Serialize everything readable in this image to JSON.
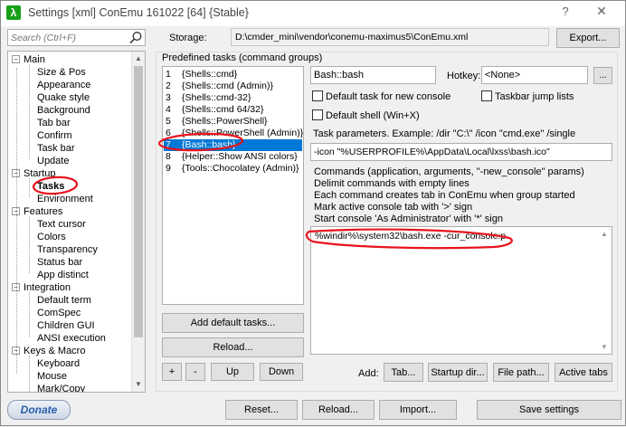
{
  "window": {
    "title": "Settings [xml] ConEmu 161022 [64] {Stable}",
    "app_icon_glyph": "λ",
    "help_label": "?",
    "close_label": "✕"
  },
  "search": {
    "placeholder": "Search (Ctrl+F)"
  },
  "storage": {
    "label": "Storage:",
    "path": "D:\\cmder_mini\\vendor\\conemu-maximus5\\ConEmu.xml",
    "export_label": "Export..."
  },
  "tree": {
    "main": "Main",
    "main_children": [
      "Size & Pos",
      "Appearance",
      "Quake style",
      "Background",
      "Tab bar",
      "Confirm",
      "Task bar",
      "Update"
    ],
    "startup": "Startup",
    "startup_children": [
      "Tasks",
      "Environment"
    ],
    "features": "Features",
    "features_children": [
      "Text cursor",
      "Colors",
      "Transparency",
      "Status bar",
      "App distinct"
    ],
    "integration": "Integration",
    "integration_children": [
      "Default term",
      "ComSpec",
      "Children GUI",
      "ANSI execution"
    ],
    "keys": "Keys & Macro",
    "keys_children": [
      "Keyboard",
      "Mouse",
      "Mark/Copy"
    ]
  },
  "tasks": {
    "group_title": "Predefined tasks (command groups)",
    "items": [
      {
        "num": "1",
        "name": "{Shells::cmd}"
      },
      {
        "num": "2",
        "name": "{Shells::cmd (Admin)}"
      },
      {
        "num": "3",
        "name": "{Shells::cmd-32}"
      },
      {
        "num": "4",
        "name": "{Shells::cmd 64/32}"
      },
      {
        "num": "5",
        "name": "{Shells::PowerShell}"
      },
      {
        "num": "6",
        "name": "{Shells::PowerShell (Admin)}"
      },
      {
        "num": "7",
        "name": "{Bash::bash}"
      },
      {
        "num": "8",
        "name": "{Helper::Show ANSI colors}"
      },
      {
        "num": "9",
        "name": "{Tools::Chocolatey (Admin)}"
      }
    ],
    "add_default_label": "Add default tasks...",
    "reload_label": "Reload...",
    "plus_label": "+",
    "minus_label": "-",
    "up_label": "Up",
    "down_label": "Down"
  },
  "task_detail": {
    "name": "Bash::bash",
    "hotkey_label": "Hotkey:",
    "hotkey_value": "<None>",
    "hotkey_more": "...",
    "default_task_label": "Default task for new console",
    "taskbar_jump_label": "Taskbar jump lists",
    "default_shell_label": "Default shell (Win+X)",
    "params_label": "Task parameters. Example: /dir \"C:\\\" /icon \"cmd.exe\" /single",
    "params_value": "-icon \"%USERPROFILE%\\AppData\\Local\\lxss\\bash.ico\"",
    "help_lines": [
      "Commands (application, arguments, \"-new_console\" params)",
      "Delimit commands with empty lines",
      "Each command creates tab in ConEmu when group started",
      "Mark active console tab with '>' sign",
      "Start console 'As Administrator' with '*' sign"
    ],
    "commands": "%windir%\\system32\\bash.exe -cur_console:p",
    "add_label": "Add:",
    "tab_btn": "Tab...",
    "startup_dir_btn": "Startup dir...",
    "file_path_btn": "File path...",
    "active_tabs_btn": "Active tabs"
  },
  "footer": {
    "donate": "Donate",
    "reset": "Reset...",
    "reload": "Reload...",
    "import": "Import...",
    "save": "Save settings"
  },
  "colors": {
    "selection": "#0078d7",
    "annotation_red": "#e8141e",
    "donate_blue": "#2b5fab"
  }
}
